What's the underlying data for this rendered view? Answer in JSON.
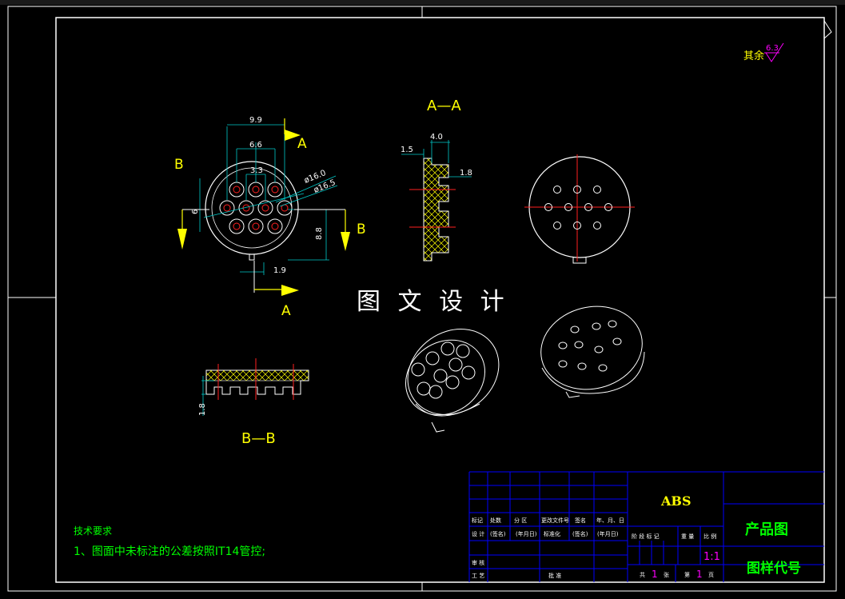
{
  "colors": {
    "background": "#000000",
    "frame": "#ffffff",
    "outline": "#ffffff",
    "hole": "#ff2020",
    "centerline": "#ff2020",
    "dimension": "#00c8c8",
    "dim_text": "#ffffff",
    "section_arrow": "#ffff00",
    "hatch": "#ffff00",
    "title_grid": "#0000ff",
    "title_text": "#ffffff",
    "title_green": "#00ff00",
    "magenta": "#ff00ff",
    "watermark": "#ffffff"
  },
  "roughness": {
    "prefix": "其余",
    "value": "6.3"
  },
  "views": {
    "front": {
      "label_b_left": "B",
      "label_b_right": "B",
      "label_a_top": "A",
      "label_a_bottom": "A",
      "dims": {
        "d9_9": "9.9",
        "d6_6": "6.6",
        "d3_3": "3.3",
        "d16_0": "ø16.0",
        "d16_5": "ø16.5",
        "d8_8": "8.8",
        "d1_9": "1.9",
        "d6_left": "6"
      }
    },
    "section_aa": {
      "title": "A—A",
      "dims": {
        "d4_0": "4.0",
        "d1_5": "1.5",
        "d1_8": "1.8"
      }
    },
    "section_bb": {
      "title": "B—B",
      "dims": {
        "d1_8": "1.8"
      }
    }
  },
  "watermark": "图 文 设 计",
  "tech_requirements": {
    "title": "技术要求",
    "line1": "1、图面中未标注的公差按照IT14管控;"
  },
  "title_block": {
    "material": "ABS",
    "product_name": "产品图",
    "drawing_code": "图样代号",
    "scale": "1:1",
    "h_biaoji": "标记",
    "h_chushu": "处数",
    "h_fenqu": "分 区",
    "h_gengwen": "更改文件号",
    "h_qianming": "签名",
    "h_nianyueri": "年、月、日",
    "h_sheji": "设 计",
    "h_qianming2": "(签名)",
    "h_nianyueri2": "(年月日)",
    "h_biaozhunhua": "标准化",
    "h_qianming3": "(签名)",
    "h_nianyueri3": "(年月日)",
    "h_jieduan": "阶 段 标 记",
    "h_zhongliang": "重 量",
    "h_bili": "比 例",
    "h_shenhe": "审 核",
    "h_gongyi": "工 艺",
    "h_pizhun": "批 准",
    "h_gong": "共",
    "h_gong_n": "1",
    "h_zhang": "张",
    "h_di": "第",
    "h_di_n": "1",
    "h_ye": "页"
  }
}
